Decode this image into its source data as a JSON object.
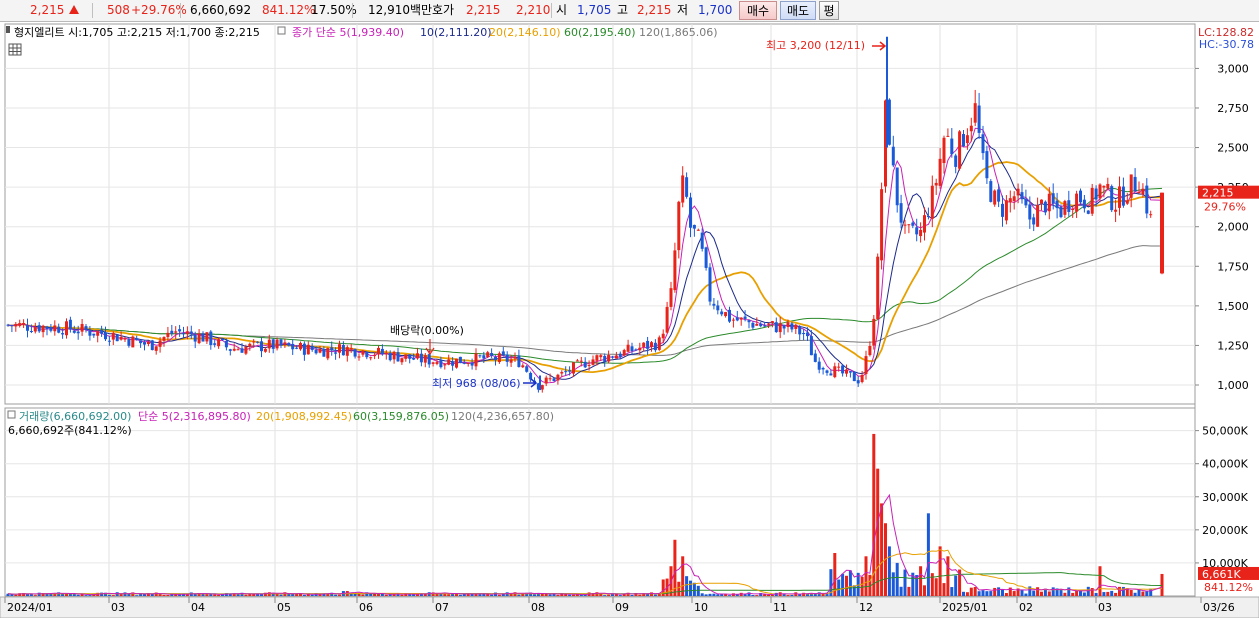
{
  "quote": {
    "price": "2,215",
    "change": "508",
    "change_pct": "+29.76%",
    "volume": "6,660,692",
    "volume_ratio": "841.12%",
    "turnover": "17.50%",
    "amount": "12,910백만",
    "ask_label": "호가",
    "ask": "2,215",
    "bid": "2,210",
    "open_label": "시",
    "open": "1,705",
    "high_label": "고",
    "high": "2,215",
    "low_label": "저",
    "low": "1,700",
    "buy_button": "매수",
    "sell_button": "매도",
    "eval_button": "평"
  },
  "colors": {
    "up": "#e8231a",
    "down": "#1a5ad8",
    "ma5": "#c821b8",
    "ma10": "#1c2a8c",
    "ma20": "#e8a000",
    "ma60": "#2a8a2a",
    "ma120": "#7a7a7a"
  },
  "price_panel": {
    "header": "형지엘리트 시:1,705 고:2,215 저:1,700 종:2,215",
    "ma_legend": [
      {
        "label": "종가 단순 5(1,939.40)",
        "color": "#c821b8"
      },
      {
        "label": "10(2,111.20)",
        "color": "#1c2a8c"
      },
      {
        "label": "20(2,146.10)",
        "color": "#e8a000"
      },
      {
        "label": "60(2,195.40)",
        "color": "#2a8a2a"
      },
      {
        "label": "120(1,865.06)",
        "color": "#7a7a7a"
      }
    ],
    "lc": "LC:128.82",
    "hc": "HC:-30.78",
    "current_price_tag": "2,215",
    "current_pct_tag": "29.76%",
    "high_annotation": "최고 3,200 (12/11)",
    "low_annotation": "최저 968 (08/06)",
    "dividend_annotation": "배당락(0.00%)"
  },
  "volume_panel": {
    "legend": [
      {
        "label": "거래량(6,660,692.00)",
        "color": "#2a8a8a"
      },
      {
        "label": "단순 5(2,316,895.80)",
        "color": "#c821b8"
      },
      {
        "label": "20(1,908,992.45)",
        "color": "#e8a000"
      },
      {
        "label": "60(3,159,876.05)",
        "color": "#2a8a2a"
      },
      {
        "label": "120(4,236,657.80)",
        "color": "#7a7a7a"
      }
    ],
    "sub_label": "6,660,692주(841.12%)",
    "current_volume_tag": "6,661K",
    "current_volume_pct": "841.12%"
  },
  "chart_data": [
    {
      "type": "candlestick",
      "title": "형지엘리트",
      "y_axis_ticks": [
        "1,000",
        "1,250",
        "1,500",
        "1,750",
        "2,000",
        "2,250",
        "2,500",
        "2,750",
        "3,000"
      ],
      "ylim": [
        880,
        3230
      ],
      "x_axis_labels": [
        "2024/01",
        "03",
        "04",
        "05",
        "06",
        "07",
        "08",
        "09",
        "10",
        "11",
        "12",
        "2025/01",
        "02",
        "03",
        "03/26"
      ],
      "months": [
        "2024-01",
        "2024-02",
        "2024-03",
        "2024-04",
        "2024-05",
        "2024-06",
        "2024-07",
        "2024-08",
        "2024-09",
        "2024-10",
        "2024-11",
        "2024-12",
        "2025-01",
        "2025-02",
        "2025-03"
      ],
      "monthly_close_approx": [
        1360,
        1330,
        1240,
        1220,
        1210,
        1160,
        1160,
        1100,
        1230,
        1400,
        1320,
        2300,
        2250,
        2100,
        2215
      ],
      "highest": {
        "date": "12/11",
        "value": 3200
      },
      "lowest": {
        "date": "08/06",
        "value": 968
      },
      "last_candle": {
        "open": 1705,
        "high": 2215,
        "low": 1700,
        "close": 2215
      },
      "moving_averages": {
        "ma5": 1939.4,
        "ma10": 2111.2,
        "ma20": 2146.1,
        "ma60": 2195.4,
        "ma120": 1865.06
      }
    },
    {
      "type": "bar",
      "title": "거래량",
      "y_axis_ticks": [
        "10,000K",
        "20,000K",
        "30,000K",
        "40,000K",
        "50,000K"
      ],
      "ylim": [
        0,
        52000
      ],
      "unit": "K",
      "peaks_k": [
        {
          "month": "2024-09",
          "value": 17000
        },
        {
          "month": "2024-12",
          "value": 49000
        },
        {
          "month": "2024-12",
          "value": 38500
        },
        {
          "month": "2025-01",
          "value": 15000
        }
      ],
      "last_value_k": 6661
    }
  ]
}
